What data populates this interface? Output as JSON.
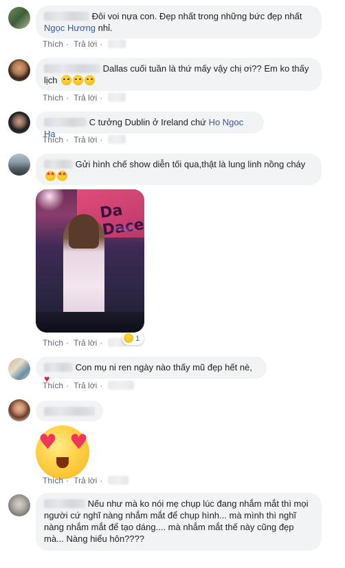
{
  "actions": {
    "like": "Thích",
    "reply": "Trả lời"
  },
  "comments": [
    {
      "text": "Đôi voi nựa con. Đẹp nhất trong những bức đẹp nhất",
      "tag": "Ngọc Hương",
      "suffix": "nhỉ.",
      "time": "1 tuần"
    },
    {
      "text": "Dallas cuối tuần là thứ mấy vậy chị ơi?? Em ko thấy lịch",
      "time": "2 tuần"
    },
    {
      "text": "C tưởng Dublin ở Ireland chứ",
      "tag": "Ho Ngoc Ha",
      "time": "2 tuần"
    },
    {
      "name_partial": "H... M...",
      "text": "Gửi hình chế show diễn tối qua,thật là lung linh nồng cháy",
      "reaction_count": "1",
      "photo_text": "Da Dace"
    },
    {
      "text": "Con mụ ni ren ngày nào thấy mũ đẹp hết nè,",
      "time": "2 tuần"
    },
    {
      "time": "3 tuần"
    },
    {
      "text": "Nếu như mà ko nói mẹ chụp lúc đang nhắm mắt thì mọi người cứ nghĩ nàng nhắm mắt để chụp hình... mà mình thì nghĩ nàng nhắm mắt để tạo dáng.... mà nhắm mắt thế này cũng đẹp mà... Nàng hiểu hôn????"
    }
  ],
  "colors": {
    "bubble": "#f2f3f5",
    "link": "#385898",
    "meta": "#606770",
    "heart": "#e41e3f"
  },
  "icons": [
    "crying-face-emoji",
    "star-struck-emoji",
    "red-heart-emoji",
    "heart-eyes-emoji",
    "laughing-reaction-emoji"
  ]
}
